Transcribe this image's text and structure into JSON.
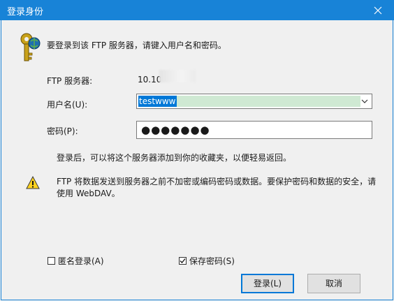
{
  "window": {
    "title": "登录身份",
    "close_icon": "close-icon"
  },
  "dialog": {
    "intro_text": "要登录到该 FTP 服务器，请键入用户名和密码。",
    "server_label": "FTP 服务器:",
    "server_value": "10.10",
    "username_label": "用户名(U):",
    "username_value": "testwww",
    "password_label": "密码(P):",
    "password_value": "●●●●●●●",
    "after_login_note": "登录后，可以将这个服务器添加到你的收藏夹，以便轻易返回。",
    "warning_text": "FTP 将数据发送到服务器之前不加密或编码密码或数据。要保护密码和数据的安全，请使用 WebDAV。",
    "anonymous_label": "匿名登录(A)",
    "anonymous_checked": false,
    "save_password_label": "保存密码(S)",
    "save_password_checked": true,
    "login_button": "登录(L)",
    "cancel_button": "取消"
  },
  "icons": [
    "keys-icon",
    "warning-icon",
    "chevron-down-icon",
    "checkmark-icon"
  ],
  "colors": {
    "titlebar": "#1883d7",
    "selection": "#0078d7",
    "default_button_border": "#0078d7"
  }
}
